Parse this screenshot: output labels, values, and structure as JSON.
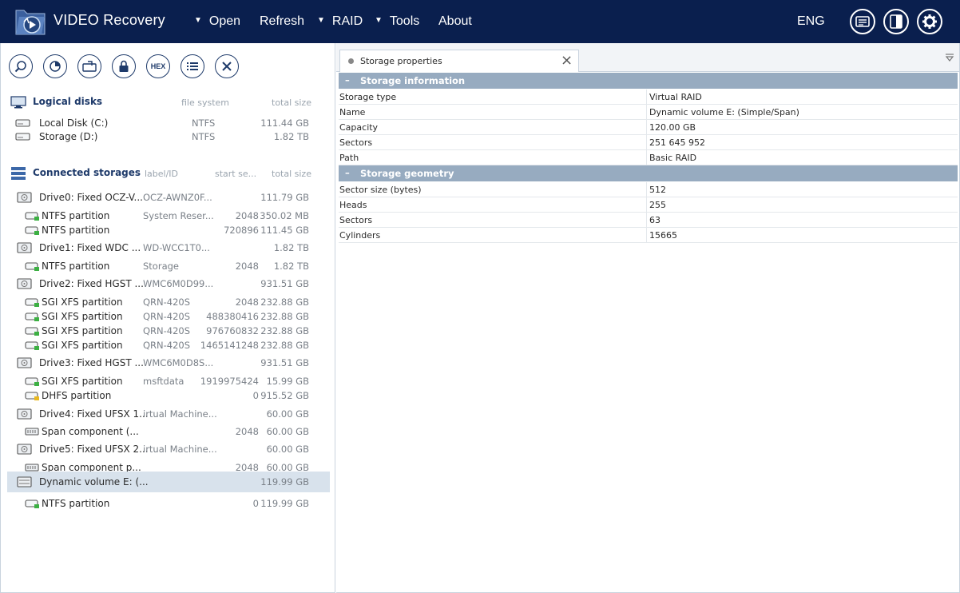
{
  "app": {
    "title": "VIDEO Recovery",
    "menu": [
      {
        "label": "Open",
        "has_dropdown": true
      },
      {
        "label": "Refresh",
        "has_dropdown": false
      },
      {
        "label": "RAID",
        "has_dropdown": true
      },
      {
        "label": "Tools",
        "has_dropdown": true
      },
      {
        "label": "About",
        "has_dropdown": false
      }
    ],
    "language": "ENG",
    "header_icons": [
      "log-icon",
      "panel-toggle-icon",
      "settings-gear-icon"
    ]
  },
  "toolbar": {
    "buttons": [
      {
        "icon": "search-scan-icon"
      },
      {
        "icon": "pie-scan-icon"
      },
      {
        "icon": "image-file-icon"
      },
      {
        "icon": "lock-icon"
      },
      {
        "icon": "hex-icon",
        "label": "HEX"
      },
      {
        "icon": "list-icon"
      },
      {
        "icon": "close-icon"
      }
    ]
  },
  "logical_disks": {
    "title": "Logical disks",
    "col_fs": "file system",
    "col_size": "total size",
    "items": [
      {
        "name": "Local Disk (C:)",
        "fs": "NTFS",
        "size": "111.44 GB"
      },
      {
        "name": "Storage (D:)",
        "fs": "NTFS",
        "size": "1.82 TB"
      }
    ]
  },
  "connected": {
    "title": "Connected storages",
    "col_label": "label/ID",
    "col_start": "start se...",
    "col_size": "total size",
    "items": [
      {
        "kind": "drive",
        "name": "Drive0: Fixed OCZ-V...",
        "label": "OCZ-AWNZ0F...",
        "start": "",
        "size": "111.79 GB"
      },
      {
        "kind": "part",
        "name": "NTFS partition",
        "label": "System Reser...",
        "start": "2048",
        "size": "350.02 MB",
        "status": "green"
      },
      {
        "kind": "part",
        "name": "NTFS partition",
        "label": "",
        "start": "720896",
        "size": "111.45 GB",
        "status": "green"
      },
      {
        "kind": "drive",
        "name": "Drive1: Fixed WDC ...",
        "label": "WD-WCC1T0...",
        "start": "",
        "size": "1.82 TB"
      },
      {
        "kind": "part",
        "name": "NTFS partition",
        "label": "Storage",
        "start": "2048",
        "size": "1.82 TB",
        "status": "green"
      },
      {
        "kind": "drive",
        "name": "Drive2: Fixed HGST ...",
        "label": "WMC6M0D99...",
        "start": "",
        "size": "931.51 GB"
      },
      {
        "kind": "part",
        "name": "SGI XFS partition",
        "label": "QRN-420S",
        "start": "2048",
        "size": "232.88 GB",
        "status": "green"
      },
      {
        "kind": "part",
        "name": "SGI XFS partition",
        "label": "QRN-420S",
        "start": "488380416",
        "size": "232.88 GB",
        "status": "green"
      },
      {
        "kind": "part",
        "name": "SGI XFS partition",
        "label": "QRN-420S",
        "start": "976760832",
        "size": "232.88 GB",
        "status": "green"
      },
      {
        "kind": "part",
        "name": "SGI XFS partition",
        "label": "QRN-420S",
        "start": "1465141248",
        "size": "232.88 GB",
        "status": "green"
      },
      {
        "kind": "drive",
        "name": "Drive3: Fixed HGST ...",
        "label": "WMC6M0D8S...",
        "start": "",
        "size": "931.51 GB"
      },
      {
        "kind": "part",
        "name": "SGI XFS partition",
        "label": "msftdata",
        "start": "1919975424",
        "size": "15.99 GB",
        "status": "green"
      },
      {
        "kind": "part",
        "name": "DHFS partition",
        "label": "",
        "start": "0",
        "size": "915.52 GB",
        "status": "yellow"
      },
      {
        "kind": "drive",
        "name": "Drive4: Fixed UFSX 1...",
        "label": "irtual Machine...",
        "start": "",
        "size": "60.00 GB"
      },
      {
        "kind": "span",
        "name": "Span component (...",
        "label": "",
        "start": "2048",
        "size": "60.00 GB"
      },
      {
        "kind": "drive",
        "name": "Drive5: Fixed UFSX 2...",
        "label": "irtual Machine...",
        "start": "",
        "size": "60.00 GB"
      },
      {
        "kind": "span",
        "name": "Span component p...",
        "label": "",
        "start": "2048",
        "size": "60.00 GB"
      },
      {
        "kind": "raid",
        "name": "Dynamic volume E: (...",
        "label": "",
        "start": "",
        "size": "119.99 GB",
        "selected": true
      },
      {
        "kind": "part",
        "name": "NTFS partition",
        "label": "",
        "start": "0",
        "size": "119.99 GB",
        "status": "green"
      }
    ]
  },
  "properties": {
    "tab_label": "Storage properties",
    "groups": [
      {
        "title": "Storage information",
        "rows": [
          {
            "key": "Storage type",
            "value": "Virtual RAID"
          },
          {
            "key": "Name",
            "value": "Dynamic volume E: (Simple/Span)"
          },
          {
            "key": "Capacity",
            "value": "120.00 GB"
          },
          {
            "key": "Sectors",
            "value": "251 645 952"
          },
          {
            "key": "Path",
            "value": "Basic RAID"
          }
        ]
      },
      {
        "title": "Storage geometry",
        "rows": [
          {
            "key": "Sector size (bytes)",
            "value": "512"
          },
          {
            "key": "Heads",
            "value": "255"
          },
          {
            "key": "Sectors",
            "value": "63"
          },
          {
            "key": "Cylinders",
            "value": "15665"
          }
        ]
      }
    ]
  },
  "colors": {
    "header_bg": "#0a1f4e",
    "group_head_bg": "#97abc0",
    "selected_row_bg": "#d8e2ec",
    "accent": "#1e3a6a",
    "status_green": "#3cb043",
    "status_yellow": "#e8b820"
  }
}
